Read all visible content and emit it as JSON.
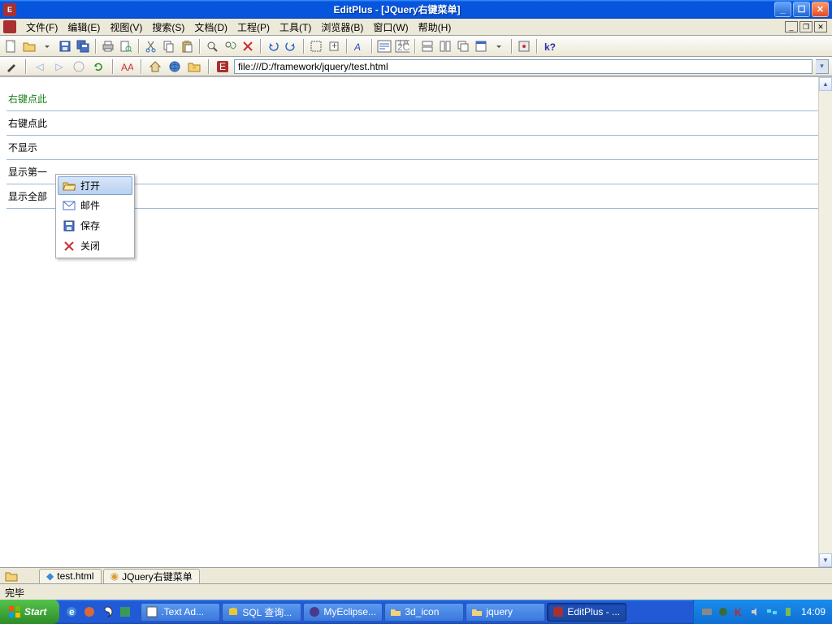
{
  "title": "EditPlus - [JQuery右键菜单]",
  "menus": {
    "file": "文件(F)",
    "edit": "编辑(E)",
    "view": "视图(V)",
    "search": "搜索(S)",
    "document": "文档(D)",
    "project": "工程(P)",
    "tools": "工具(T)",
    "browser": "浏览器(B)",
    "window": "窗口(W)",
    "help": "帮助(H)"
  },
  "address": "file:///D:/framework/jquery/test.html",
  "page_rows": {
    "r1": "右键点此",
    "r2": "右键点此",
    "r3": "不显示",
    "r4": "显示第一",
    "r5": "显示全部"
  },
  "ctx": {
    "open": "打开",
    "mail": "邮件",
    "save": "保存",
    "close": "关闭"
  },
  "tabs": {
    "t1": "test.html",
    "t2": "JQuery右键菜单"
  },
  "status": "完毕",
  "start": "Start",
  "taskbtns": {
    "b1": ".Text Ad...",
    "b2": "SQL 查询...",
    "b3": "MyEclipse...",
    "b4": "3d_icon",
    "b5": "jquery",
    "b6": "EditPlus - ..."
  },
  "clock": "14:09"
}
